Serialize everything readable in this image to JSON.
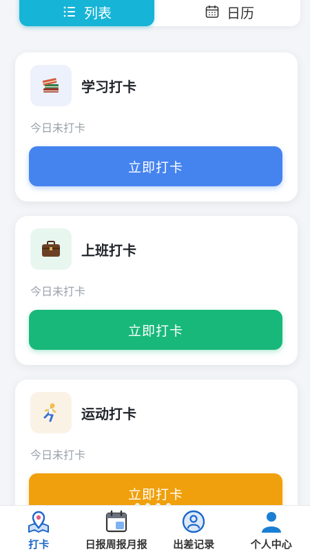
{
  "tabs": {
    "list_label": "列表",
    "calendar_label": "日历"
  },
  "cards": [
    {
      "title": "学习打卡",
      "status": "今日未打卡",
      "button": "立即打卡",
      "icon": "books-icon",
      "color": "#4583ef"
    },
    {
      "title": "上班打卡",
      "status": "今日未打卡",
      "button": "立即打卡",
      "icon": "briefcase-icon",
      "color": "#18b87b"
    },
    {
      "title": "运动打卡",
      "status": "今日未打卡",
      "button": "立即打卡",
      "icon": "runner-icon",
      "color": "#f0a00c"
    }
  ],
  "nav": {
    "items": [
      {
        "label": "打卡",
        "icon": "map-pin-icon",
        "active": true
      },
      {
        "label": "日报周报月报",
        "icon": "calendar-icon",
        "active": false
      },
      {
        "label": "出差记录",
        "icon": "person-circle-icon",
        "active": false
      },
      {
        "label": "个人中心",
        "icon": "user-icon",
        "active": false
      }
    ]
  },
  "colors": {
    "tab_active": "#16b4d6",
    "nav_active": "#1a66c9"
  }
}
